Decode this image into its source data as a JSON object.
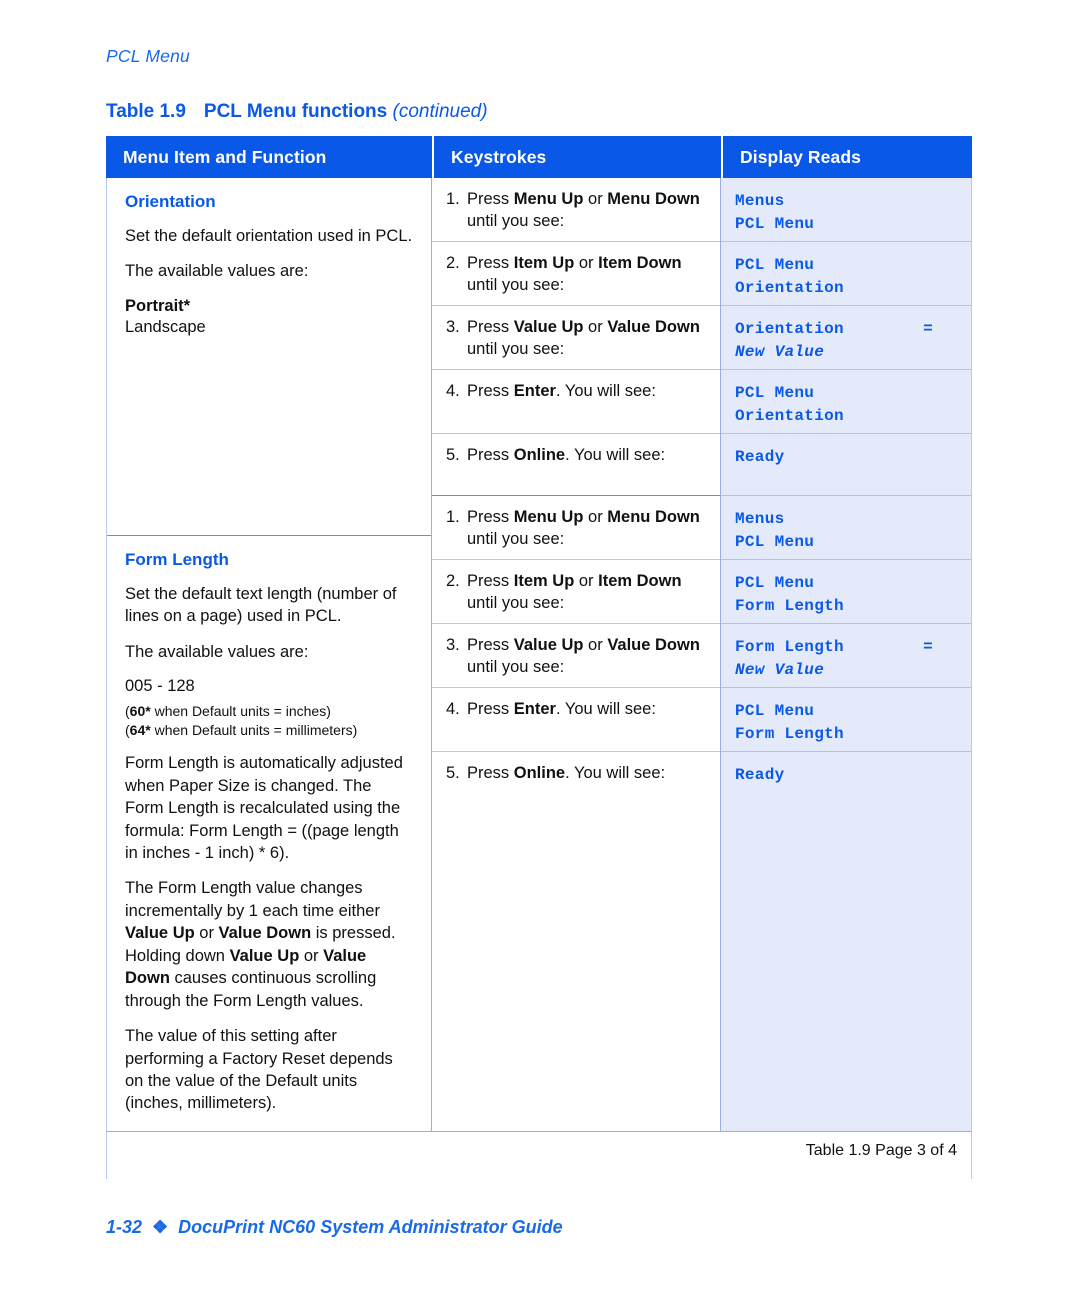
{
  "running_head": "PCL Menu",
  "colors": {
    "header_blue": "#0A58E8",
    "accent_blue": "#1A6AE8",
    "display_bg": "#E5EAFB",
    "rule_light": "#B9C9F2",
    "rule_mid": "#9AAFE6",
    "section_rule": "#8C8C8C"
  },
  "table": {
    "caption_number": "Table 1.9",
    "caption_title": "PCL Menu functions",
    "caption_continued": "(continued)",
    "headers": {
      "col1": "Menu Item and Function",
      "col2": "Keystrokes",
      "col3": "Display Reads"
    },
    "footer_note": "Table 1.9  Page 3 of 4",
    "sections": [
      {
        "id": "orientation",
        "function": {
          "title": "Orientation",
          "paragraphs": [
            "Set the default orientation used in PCL.",
            "The available values are:"
          ],
          "values_bold": "Portrait*",
          "values_plain": "Landscape"
        },
        "steps": [
          {
            "num": "1.",
            "text_html": "Press <b>Menu Up</b> or <b>Menu Down</b> until you see:",
            "display_line1": "Menus",
            "display_line2": "PCL Menu",
            "display_line2_italic": false,
            "display_eq": ""
          },
          {
            "num": "2.",
            "text_html": "Press <b>Item Up</b> or <b>Item Down</b> until you see:",
            "display_line1": "PCL Menu",
            "display_line2": "Orientation",
            "display_line2_italic": false,
            "display_eq": ""
          },
          {
            "num": "3.",
            "text_html": "Press <b>Value Up</b> or <b>Value Down</b> until you see:",
            "display_line1": "Orientation",
            "display_line2": "New Value",
            "display_line2_italic": true,
            "display_eq": "="
          },
          {
            "num": "4.",
            "text_html": "Press <b>Enter</b>. You will see:",
            "display_line1": "PCL Menu",
            "display_line2": "Orientation",
            "display_line2_italic": false,
            "display_eq": ""
          },
          {
            "num": "5.",
            "text_html": "Press <b>Online</b>. You will see:",
            "display_line1": "Ready",
            "display_line2": "",
            "display_line2_italic": false,
            "display_eq": ""
          }
        ]
      },
      {
        "id": "form-length",
        "function": {
          "title": "Form Length",
          "paragraphs": [
            "Set the default text length (number of lines on a page) used in PCL.",
            "The available values are:"
          ],
          "values_range": "005 - 128",
          "values_note_inches_bold": "60*",
          "values_note_inches": " when Default units = inches)",
          "values_note_mm_bold": "64*",
          "values_note_mm": " when Default units = millimeters)",
          "extra_paragraphs_html": [
            "Form Length is automatically adjusted when Paper Size is changed. The Form Length is recalculated using the formula: Form Length = ((page length in inches - 1 inch) * 6).",
            "The Form Length value changes incrementally by 1 each time either <b>Value Up</b> or <b>Value Down</b> is pressed. Holding down <b>Value Up</b> or <b>Value Down</b> causes continuous scrolling through the Form Length values.",
            "The value of this setting after performing a Factory Reset depends on the value of the Default units (inches, millimeters)."
          ]
        },
        "steps": [
          {
            "num": "1.",
            "text_html": "Press <b>Menu Up</b> or <b>Menu Down</b> until you see:",
            "display_line1": "Menus",
            "display_line2": "PCL Menu",
            "display_line2_italic": false,
            "display_eq": ""
          },
          {
            "num": "2.",
            "text_html": "Press <b>Item Up</b> or <b>Item Down</b> until you see:",
            "display_line1": "PCL Menu",
            "display_line2": "Form Length",
            "display_line2_italic": false,
            "display_eq": ""
          },
          {
            "num": "3.",
            "text_html": "Press <b>Value Up</b> or <b>Value Down</b> until you see:",
            "display_line1": "Form Length",
            "display_line2": "New Value",
            "display_line2_italic": true,
            "display_eq": "="
          },
          {
            "num": "4.",
            "text_html": "Press <b>Enter</b>. You will see:",
            "display_line1": "PCL Menu",
            "display_line2": "Form Length",
            "display_line2_italic": false,
            "display_eq": ""
          },
          {
            "num": "5.",
            "text_html": "Press <b>Online</b>. You will see:",
            "display_line1": "Ready",
            "display_line2": "",
            "display_line2_italic": false,
            "display_eq": ""
          }
        ]
      }
    ]
  },
  "page_footer": {
    "page_number": "1-32",
    "diamond": "❖",
    "title": "DocuPrint NC60 System Administrator Guide"
  }
}
